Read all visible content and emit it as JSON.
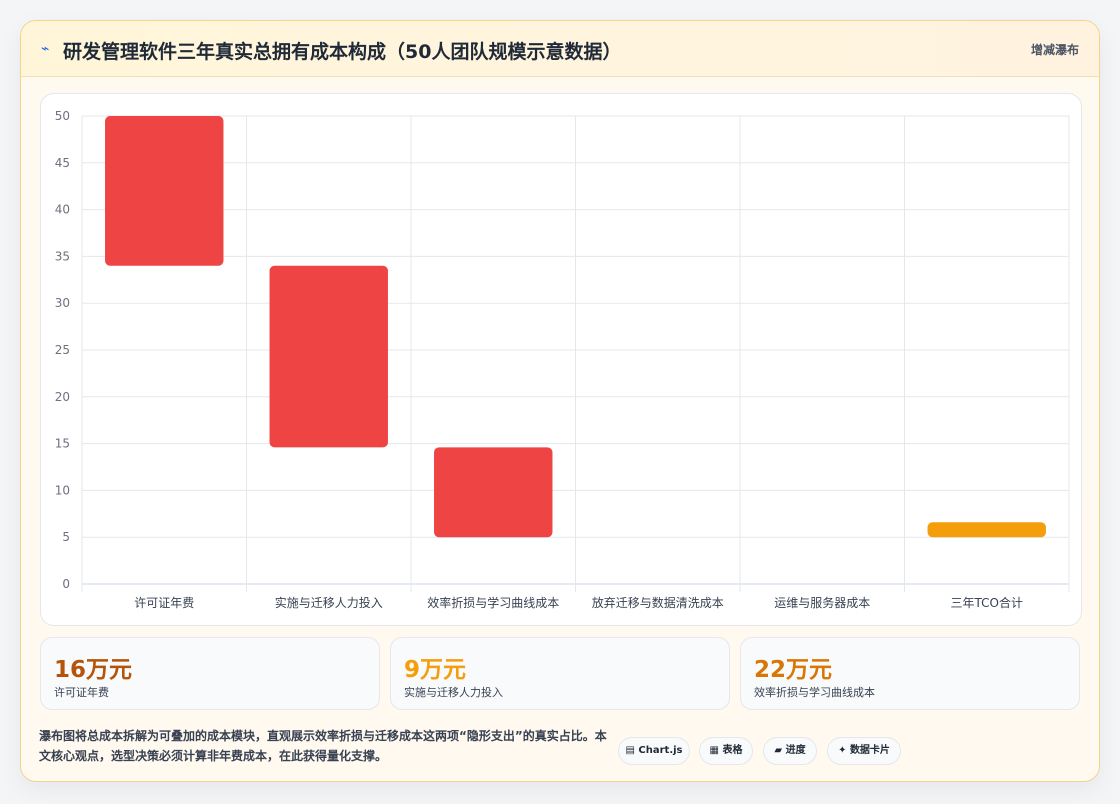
{
  "header": {
    "icon": "pulse-icon",
    "icon_glyph": "⌁",
    "title": "研发管理软件三年真实总拥有成本构成（50人团队规模示意数据）",
    "right_label": "增减瀑布"
  },
  "colors": {
    "cost": "#ef4444",
    "total": "#f59e0b",
    "stat1": "#b45309",
    "stat2": "#f59e0b",
    "stat3": "#d97706"
  },
  "chart_data": {
    "type": "bar",
    "subtype": "waterfall",
    "categories": [
      "许可证年费",
      "实施与迁移人力投入",
      "效率折损与学习曲线成本",
      "放弃迁移与数据清洗成本",
      "运维与服务器成本",
      "三年TCO合计"
    ],
    "series": [
      {
        "ranges": [
          [
            34,
            50
          ],
          [
            14.6,
            34
          ],
          [
            5,
            14.6
          ],
          null,
          null,
          [
            5,
            6.6
          ]
        ],
        "kinds": [
          "cost",
          "cost",
          "cost",
          "cost",
          "cost",
          "total"
        ]
      }
    ],
    "ylim": [
      0,
      50
    ],
    "yticks": [
      0,
      5,
      10,
      15,
      20,
      25,
      30,
      35,
      40,
      45,
      50
    ],
    "grid": true,
    "legend": "none"
  },
  "stats": [
    {
      "value": "16万元",
      "label": "许可证年费"
    },
    {
      "value": "9万元",
      "label": "实施与迁移人力投入"
    },
    {
      "value": "22万元",
      "label": "效率折损与学习曲线成本"
    }
  ],
  "footer": {
    "text": "瀑布图将总成本拆解为可叠加的成本模块，直观展示效率折损与迁移成本这两项“隐形支出”的真实占比。本文核心观点，选型决策必须计算非年费成本，在此获得量化支撑。",
    "chips": [
      {
        "icon": "chart-icon",
        "glyph": "▤",
        "label": "Chart.js"
      },
      {
        "icon": "table-icon",
        "glyph": "▦",
        "label": "表格"
      },
      {
        "icon": "progress-icon",
        "glyph": "▰",
        "label": "进度"
      },
      {
        "icon": "sparkle-icon",
        "glyph": "✦",
        "label": "数据卡片"
      }
    ]
  }
}
